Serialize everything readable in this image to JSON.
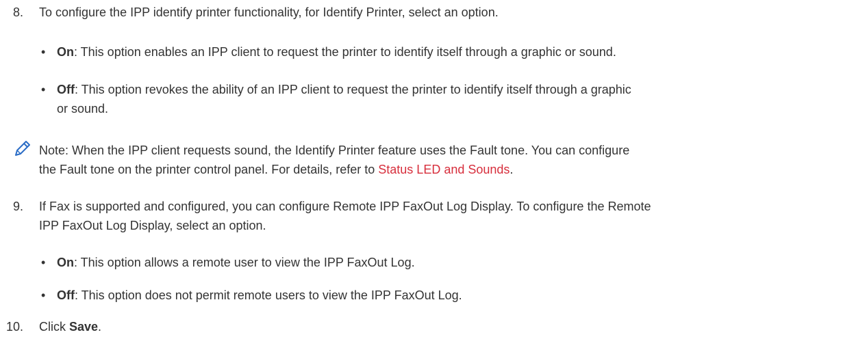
{
  "step8": {
    "number": "8.",
    "text": "To configure the IPP identify printer functionality, for Identify Printer, select an option.",
    "bullets": [
      {
        "term": "On",
        "text": ": This option enables an IPP client to request the printer to identify itself through a graphic or sound."
      },
      {
        "term": "Off",
        "text_line1": ": This option revokes the ability of an IPP client to request the printer to identify itself through a graphic",
        "text_line2": "or sound."
      }
    ]
  },
  "note": {
    "icon": "pencil-icon",
    "line1": "Note: When the IPP client requests sound, the Identify Printer feature uses the Fault tone. You can configure",
    "line2_prefix": "the Fault tone on the printer control panel. For details, refer to ",
    "link_text": "Status LED and Sounds",
    "line2_suffix": ".",
    "link_color": "#d72e3c"
  },
  "step9": {
    "number": "9.",
    "line1": "If Fax is supported and configured, you can configure Remote IPP FaxOut Log Display. To configure the Remote",
    "line2": "IPP FaxOut Log Display, select an option.",
    "bullets": [
      {
        "term": "On",
        "text": ": This option allows a remote user to view the IPP FaxOut Log."
      },
      {
        "term": "Off",
        "text": ": This option does not permit remote users to view the IPP FaxOut Log."
      }
    ]
  },
  "step10": {
    "number": "10.",
    "prefix": "Click ",
    "term": "Save",
    "suffix": "."
  },
  "colors": {
    "text": "#333333",
    "link": "#d72e3c",
    "icon": "#2b6dc6"
  }
}
